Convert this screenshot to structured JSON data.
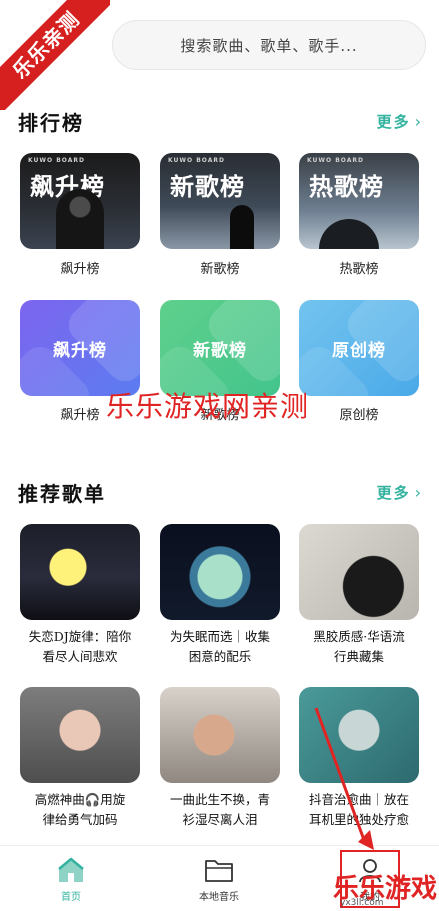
{
  "watermark": {
    "ribbon": "乐乐亲测",
    "center": "乐乐游戏网亲测",
    "brand": "乐乐游戏",
    "brand_url": "yx3ll.com"
  },
  "search": {
    "placeholder": "搜索歌曲、歌单、歌手..."
  },
  "charts_section": {
    "title": "排行榜",
    "more": "更多",
    "cards": [
      {
        "cover_text": "飙升榜",
        "board": "KUWO BOARD",
        "label": "飙升榜"
      },
      {
        "cover_text": "新歌榜",
        "board": "KUWO BOARD",
        "label": "新歌榜"
      },
      {
        "cover_text": "热歌榜",
        "board": "KUWO BOARD",
        "label": "热歌榜"
      },
      {
        "cover_text": "飙升榜",
        "label": "飙升榜"
      },
      {
        "cover_text": "新歌榜",
        "label": "新歌榜"
      },
      {
        "cover_text": "原创榜",
        "label": "原创榜"
      }
    ]
  },
  "playlists_section": {
    "title": "推荐歌单",
    "more": "更多",
    "items": [
      {
        "line1": "失恋DJ旋律：陪你",
        "line2": "看尽人间悲欢"
      },
      {
        "line1": "为失眠而选｜收集",
        "line2": "困意的配乐"
      },
      {
        "line1": "黑胶质感·华语流",
        "line2": "行典藏集"
      },
      {
        "line1": "高燃神曲🎧用旋",
        "line2": "律给勇气加码"
      },
      {
        "line1": "一曲此生不换，青",
        "line2": "衫湿尽离人泪"
      },
      {
        "line1": "抖音治愈曲｜放在",
        "line2": "耳机里的独处疗愈"
      }
    ]
  },
  "nav": [
    {
      "label": "首页",
      "active": true
    },
    {
      "label": "本地音乐",
      "active": false
    },
    {
      "label": "我的",
      "active": false
    }
  ],
  "colors": {
    "accent": "#34b3a0",
    "watermark_red": "#e02424"
  }
}
